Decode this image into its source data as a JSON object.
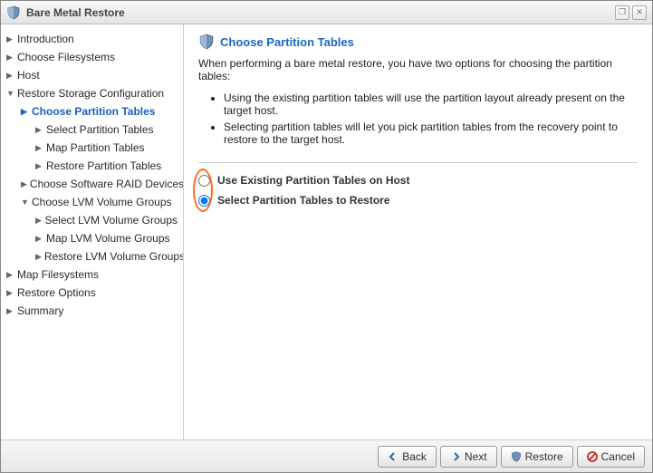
{
  "window": {
    "title": "Bare Metal Restore"
  },
  "sidebar": {
    "items": [
      {
        "label": "Introduction"
      },
      {
        "label": "Choose Filesystems"
      },
      {
        "label": "Host"
      },
      {
        "label": "Restore Storage Configuration"
      },
      {
        "label": "Choose Partition Tables"
      },
      {
        "label": "Select Partition Tables"
      },
      {
        "label": "Map Partition Tables"
      },
      {
        "label": "Restore Partition Tables"
      },
      {
        "label": "Choose Software RAID Devices"
      },
      {
        "label": "Choose LVM Volume Groups"
      },
      {
        "label": "Select LVM Volume Groups"
      },
      {
        "label": "Map LVM Volume Groups"
      },
      {
        "label": "Restore LVM Volume Groups"
      },
      {
        "label": "Map Filesystems"
      },
      {
        "label": "Restore Options"
      },
      {
        "label": "Summary"
      }
    ]
  },
  "content": {
    "heading": "Choose Partition Tables",
    "description": "When performing a bare metal restore, you have two options for choosing the partition tables:",
    "bullets": [
      "Using the existing partition tables will use the partition layout already present on the target host.",
      "Selecting partition tables will let you pick partition tables from the recovery point to restore to the target host."
    ],
    "options": [
      {
        "label": "Use Existing Partition Tables on Host",
        "selected": false
      },
      {
        "label": "Select Partition Tables to Restore",
        "selected": true
      }
    ]
  },
  "footer": {
    "back": "Back",
    "next": "Next",
    "restore": "Restore",
    "cancel": "Cancel"
  }
}
